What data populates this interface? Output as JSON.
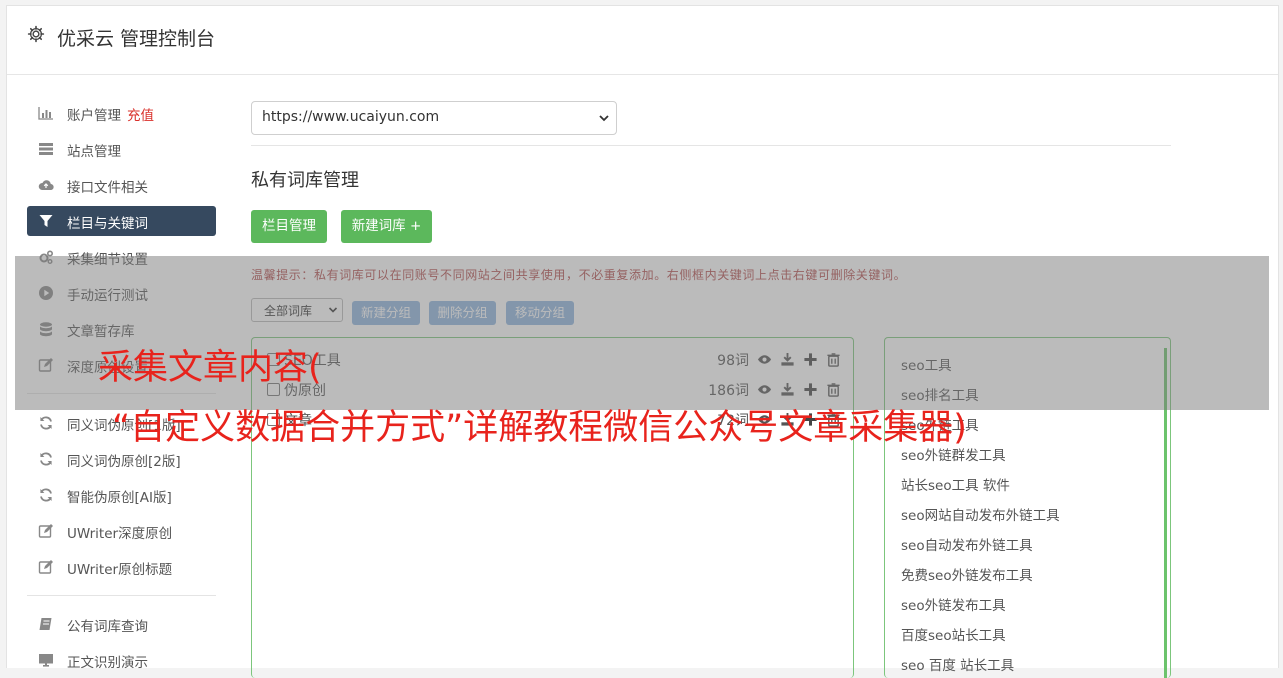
{
  "header": {
    "title": "优采云 管理控制台"
  },
  "sidebar": {
    "items": [
      {
        "label": "账户管理",
        "tag": "充值",
        "icon": "bar-chart-icon"
      },
      {
        "label": "站点管理",
        "icon": "server-icon"
      },
      {
        "label": "接口文件相关",
        "icon": "cloud-upload-icon"
      },
      {
        "label": "栏目与关键词",
        "icon": "filter-icon",
        "active": true
      },
      {
        "label": "采集细节设置",
        "icon": "gears-icon"
      },
      {
        "label": "手动运行测试",
        "icon": "play-circle-icon"
      },
      {
        "label": "文章暂存库",
        "icon": "database-icon"
      },
      {
        "label": "深度原创设置",
        "icon": "edit-icon"
      },
      {
        "label": "同义词伪原创[1版]",
        "icon": "refresh-icon"
      },
      {
        "label": "同义词伪原创[2版]",
        "icon": "refresh-icon"
      },
      {
        "label": "智能伪原创[AI版]",
        "icon": "refresh-icon"
      },
      {
        "label": "UWriter深度原创",
        "icon": "edit-icon"
      },
      {
        "label": "UWriter原创标题",
        "icon": "edit-icon"
      },
      {
        "label": "公有词库查询",
        "icon": "book-icon"
      },
      {
        "label": "正文识别演示",
        "icon": "desktop-icon"
      }
    ]
  },
  "main": {
    "site_select": "https://www.ucaiyun.com",
    "section_title": "私有词库管理",
    "buttons": {
      "columns": "栏目管理",
      "new_lib": "新建词库 +"
    },
    "tip": "温馨提示：私有词库可以在同账号不同网站之间共享使用，不必重复添加。右侧框内关键词上点击右键可删除关键词。",
    "group_select": "全部词库",
    "group_buttons": {
      "new_group": "新建分组",
      "delete_group": "删除分组",
      "move_group": "移动分组"
    },
    "libraries": [
      {
        "name": "SEO工具",
        "count": "98词"
      },
      {
        "name": "伪原创",
        "count": "186词"
      },
      {
        "name": "文章",
        "count": "72词"
      }
    ],
    "keywords": [
      "seo工具",
      "seo排名工具",
      "seo外链工具",
      "seo外链群发工具",
      "站长seo工具 软件",
      "seo网站自动发布外链工具",
      "seo自动发布外链工具",
      "免费seo外链发布工具",
      "seo外链发布工具",
      "百度seo站长工具",
      "seo 百度 站长工具"
    ]
  },
  "overlay": {
    "line1": "采集文章内容(",
    "line2": "“自定义数据合并方式”详解教程微信公众号文章采集器)"
  },
  "colors": {
    "active_nav": "#36495f",
    "green_button": "#5cb85c",
    "blue_button": "#8fb5de",
    "panel_border": "#7cc67c",
    "overlay_text": "#e8231c",
    "recharge_tag": "#d9302a"
  }
}
